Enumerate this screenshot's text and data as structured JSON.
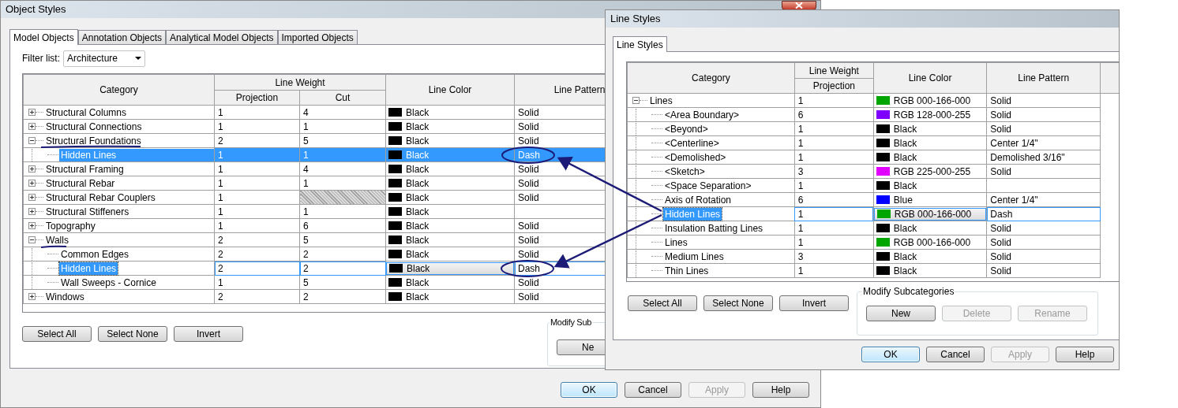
{
  "object_styles_window": {
    "title": "Object Styles",
    "tabs": [
      {
        "label": "Model Objects",
        "selected": true
      },
      {
        "label": "Annotation Objects",
        "selected": false
      },
      {
        "label": "Analytical Model Objects",
        "selected": false
      },
      {
        "label": "Imported Objects",
        "selected": false
      }
    ],
    "filter": {
      "label": "Filter list:",
      "value": "Architecture"
    },
    "table": {
      "headers": {
        "category": "Category",
        "line_weight": "Line Weight",
        "projection": "Projection",
        "cut": "Cut",
        "line_color": "Line Color",
        "line_pattern": "Line Pattern"
      },
      "rows": [
        {
          "name": "Structural Columns",
          "expanded": false,
          "selected": false,
          "editing": false,
          "projection": "1",
          "cut": "4",
          "color_name": "Black",
          "color": "#000000",
          "pattern": "Solid"
        },
        {
          "name": "Structural Connections",
          "expanded": false,
          "selected": false,
          "editing": false,
          "projection": "1",
          "cut": "1",
          "color_name": "Black",
          "color": "#000000",
          "pattern": "Solid"
        },
        {
          "name": "Structural Foundations",
          "expanded": true,
          "selected": false,
          "editing": false,
          "projection": "2",
          "cut": "5",
          "color_name": "Black",
          "color": "#000000",
          "pattern": "Solid",
          "children": [
            {
              "name": "Hidden Lines",
              "selected": true,
              "editing": false,
              "projection": "1",
              "cut": "1",
              "color_name": "Black",
              "color": "#000000",
              "pattern": "Dash"
            }
          ]
        },
        {
          "name": "Structural Framing",
          "expanded": false,
          "selected": false,
          "editing": false,
          "projection": "1",
          "cut": "4",
          "color_name": "Black",
          "color": "#000000",
          "pattern": "Solid"
        },
        {
          "name": "Structural Rebar",
          "expanded": false,
          "selected": false,
          "editing": false,
          "projection": "1",
          "cut": "1",
          "color_name": "Black",
          "color": "#000000",
          "pattern": "Solid"
        },
        {
          "name": "Structural Rebar Couplers",
          "expanded": false,
          "selected": false,
          "editing": false,
          "projection": "1",
          "color_name": "Black",
          "color": "#000000",
          "pattern": "Solid"
        },
        {
          "name": "Structural Stiffeners",
          "expanded": false,
          "selected": false,
          "editing": false,
          "projection": "1",
          "cut": "1",
          "color_name": "Black",
          "color": "#000000"
        },
        {
          "name": "Topography",
          "expanded": false,
          "selected": false,
          "editing": false,
          "projection": "1",
          "cut": "6",
          "color_name": "Black",
          "color": "#000000",
          "pattern": "Solid"
        },
        {
          "name": "Walls",
          "expanded": true,
          "selected": false,
          "editing": false,
          "projection": "2",
          "cut": "5",
          "color_name": "Black",
          "color": "#000000",
          "pattern": "Solid",
          "children": [
            {
              "name": "Common Edges",
              "selected": false,
              "editing": false,
              "projection": "2",
              "cut": "2",
              "color_name": "Black",
              "color": "#000000",
              "pattern": "Solid"
            },
            {
              "name": "Hidden Lines",
              "selected": true,
              "editing": true,
              "projection": "2",
              "cut": "2",
              "color_name": "Black",
              "color": "#000000",
              "pattern": "Dash"
            },
            {
              "name": "Wall Sweeps - Cornice",
              "selected": false,
              "editing": false,
              "projection": "1",
              "cut": "5",
              "color_name": "Black",
              "color": "#000000",
              "pattern": "Solid"
            }
          ]
        },
        {
          "name": "Windows",
          "expanded": false,
          "selected": false,
          "editing": false,
          "projection": "2",
          "cut": "2",
          "color_name": "Black",
          "color": "#000000",
          "pattern": "Solid"
        }
      ]
    },
    "buttons": [
      {
        "label": "Select All",
        "disabled": false
      },
      {
        "label": "Select None",
        "disabled": false
      },
      {
        "label": "Invert",
        "disabled": false
      }
    ],
    "modify_group": {
      "title": "Modify Sub",
      "buttons": [
        {
          "label": "Ne",
          "disabled": false
        }
      ]
    },
    "footer_buttons": [
      {
        "label": "OK",
        "disabled": false,
        "default": true
      },
      {
        "label": "Cancel",
        "disabled": false,
        "default": false
      },
      {
        "label": "Apply",
        "disabled": true,
        "default": false
      },
      {
        "label": "Help",
        "disabled": false,
        "default": false
      }
    ]
  },
  "line_styles_window": {
    "title": "Line Styles",
    "tabs": [
      {
        "label": "Line Styles",
        "selected": true
      }
    ],
    "table": {
      "headers": {
        "category": "Category",
        "line_weight": "Line Weight",
        "projection": "Projection",
        "line_color": "Line Color",
        "line_pattern": "Line Pattern"
      },
      "rows": [
        {
          "name": "Lines",
          "expanded": true,
          "selected": false,
          "editing": false,
          "projection": "1",
          "color_name": "RGB 000-166-000",
          "color": "#00a600",
          "pattern": "Solid",
          "children": [
            {
              "name": "<Area Boundary>",
              "selected": false,
              "editing": false,
              "projection": "6",
              "color_name": "RGB 128-000-255",
              "color": "#8000ff",
              "pattern": "Solid"
            },
            {
              "name": "<Beyond>",
              "selected": false,
              "editing": false,
              "projection": "1",
              "color_name": "Black",
              "color": "#000000",
              "pattern": "Solid"
            },
            {
              "name": "<Centerline>",
              "selected": false,
              "editing": false,
              "projection": "1",
              "color_name": "Black",
              "color": "#000000",
              "pattern": "Center 1/4\""
            },
            {
              "name": "<Demolished>",
              "selected": false,
              "editing": false,
              "projection": "1",
              "color_name": "Black",
              "color": "#000000",
              "pattern": "Demolished 3/16\""
            },
            {
              "name": "<Sketch>",
              "selected": false,
              "editing": false,
              "projection": "3",
              "color_name": "RGB 225-000-255",
              "color": "#e100ff",
              "pattern": "Solid"
            },
            {
              "name": "<Space Separation>",
              "selected": false,
              "editing": false,
              "projection": "1",
              "color_name": "Black",
              "color": "#000000"
            },
            {
              "name": "Axis of Rotation",
              "selected": false,
              "editing": false,
              "projection": "6",
              "color_name": "Blue",
              "color": "#0000ff",
              "pattern": "Center 1/4\""
            },
            {
              "name": "Hidden Lines",
              "selected": true,
              "editing": true,
              "projection": "1",
              "color_name": "RGB 000-166-000",
              "color": "#00a600",
              "pattern": "Dash"
            },
            {
              "name": "Insulation Batting Lines",
              "selected": false,
              "editing": false,
              "projection": "1",
              "color_name": "Black",
              "color": "#000000",
              "pattern": "Solid"
            },
            {
              "name": "Lines",
              "selected": false,
              "editing": false,
              "projection": "1",
              "color_name": "RGB 000-166-000",
              "color": "#00a600",
              "pattern": "Solid"
            },
            {
              "name": "Medium Lines",
              "selected": false,
              "editing": false,
              "projection": "3",
              "color_name": "Black",
              "color": "#000000",
              "pattern": "Solid"
            },
            {
              "name": "Thin Lines",
              "selected": false,
              "editing": false,
              "projection": "1",
              "color_name": "Black",
              "color": "#000000",
              "pattern": "Solid"
            }
          ]
        }
      ]
    },
    "buttons": [
      {
        "label": "Select All",
        "disabled": false
      },
      {
        "label": "Select None",
        "disabled": false
      },
      {
        "label": "Invert",
        "disabled": false
      }
    ],
    "modify_group": {
      "title": "Modify Subcategories",
      "buttons": [
        {
          "label": "New",
          "disabled": false
        },
        {
          "label": "Delete",
          "disabled": true
        },
        {
          "label": "Rename",
          "disabled": true
        }
      ]
    },
    "footer_buttons": [
      {
        "label": "OK",
        "disabled": false,
        "default": true
      },
      {
        "label": "Cancel",
        "disabled": false,
        "default": false
      },
      {
        "label": "Apply",
        "disabled": true,
        "default": false
      },
      {
        "label": "Help",
        "disabled": false,
        "default": false
      }
    ]
  }
}
